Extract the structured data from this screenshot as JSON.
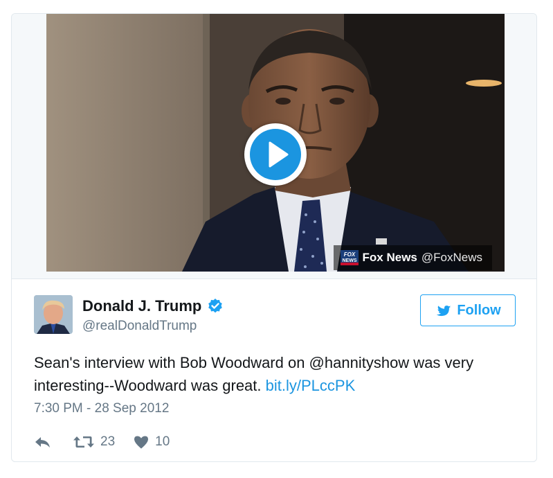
{
  "media": {
    "watermark_source": "Fox News",
    "watermark_handle": "@FoxNews",
    "logo_text_top": "FOX",
    "logo_text_bottom": "NEWS"
  },
  "tweet": {
    "display_name": "Donald J. Trump",
    "screen_name": "@realDonaldTrump",
    "verified": true,
    "follow_label": "Follow",
    "text_main": "Sean's interview with Bob Woodward on @hannityshow was very interesting--Woodward was great. ",
    "link_text": "bit.ly/PLccPK",
    "timestamp": "7:30 PM - 28 Sep 2012",
    "retweet_count": "23",
    "like_count": "10"
  },
  "icons": {
    "play": "play-icon",
    "verified": "verified-badge-icon",
    "follow_bird": "twitter-bird-icon",
    "reply": "reply-icon",
    "retweet": "retweet-icon",
    "like": "heart-icon"
  },
  "colors": {
    "brand_blue": "#1da1f2",
    "link_blue": "#1b95e0",
    "secondary_text": "#657786",
    "border": "#e1e8ed"
  }
}
